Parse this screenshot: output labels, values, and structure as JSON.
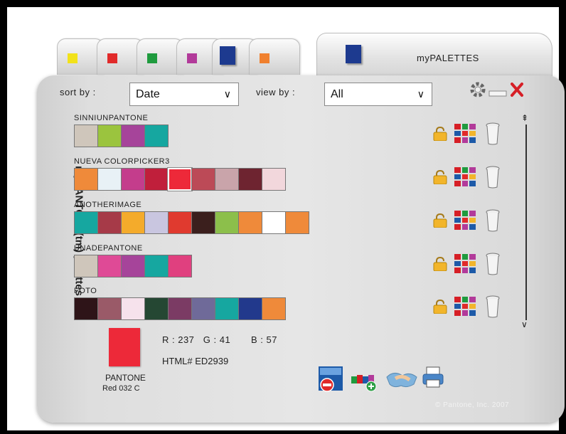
{
  "tabs": [
    {
      "color": "#f2e21a"
    },
    {
      "color": "#e12a2a"
    },
    {
      "color": "#1f9b3e"
    },
    {
      "color": "#b23a9a"
    },
    {
      "color": "#1d3a8f",
      "active": true
    },
    {
      "color": "#f0802e"
    }
  ],
  "app_tab": {
    "title": "myPALETTES",
    "color": "#1d3a8f"
  },
  "side_title": "myPANTONE(tm) palettes",
  "sort": {
    "label": "sort by :",
    "value": "Date"
  },
  "view": {
    "label": "view by :",
    "value": "All"
  },
  "window_controls": [
    "settings-icon",
    "minimize-icon",
    "close-icon"
  ],
  "palettes": [
    {
      "name": "SINNIUNPANTONE",
      "colors": [
        "#cfc6bb",
        "#9bc43e",
        "#a6449a",
        "#16a7a0"
      ]
    },
    {
      "name": "NUEVA COLORPICKER3",
      "colors": [
        "#ef8a3a",
        "#e8f1f6",
        "#c43d8c",
        "#c01f3b",
        "#ED2939",
        "#bc4a57",
        "#c9a4aa",
        "#6e2430",
        "#f2d7dc"
      ],
      "selected_index": 4
    },
    {
      "name": "ANOTHERIMAGE",
      "colors": [
        "#16a7a0",
        "#a63a48",
        "#f4ab2b",
        "#c9c6e0",
        "#e03a2f",
        "#3b1f1d",
        "#8cbf4b",
        "#ef8a3a",
        "#ffffff",
        "#ef8a3a"
      ]
    },
    {
      "name": "UNADEPANTONE",
      "colors": [
        "#cfc6bb",
        "#df4a96",
        "#a6449a",
        "#16a7a0",
        "#e0407f"
      ]
    },
    {
      "name": "FOTO",
      "colors": [
        "#2e1418",
        "#9a5a68",
        "#f6e2ec",
        "#254733",
        "#7b3b64",
        "#6f6a99",
        "#16a7a0",
        "#22398c",
        "#ef8a3a"
      ]
    }
  ],
  "row_actions": [
    "lock-icon",
    "palette-grid-icon",
    "trash-icon"
  ],
  "selected_color": {
    "r_label": "R : 237",
    "g_label": "G : 41",
    "b_label": "B : 57",
    "html": "HTML# ED2939",
    "pantone": "PANTONE",
    "name": "Red 032 C",
    "hex": "#ED2939"
  },
  "bottom_icons": [
    "delete-palette-icon",
    "add-colors-icon",
    "share-handshake-icon",
    "print-icon"
  ],
  "copyright": "© Pantone, Inc. 2007"
}
